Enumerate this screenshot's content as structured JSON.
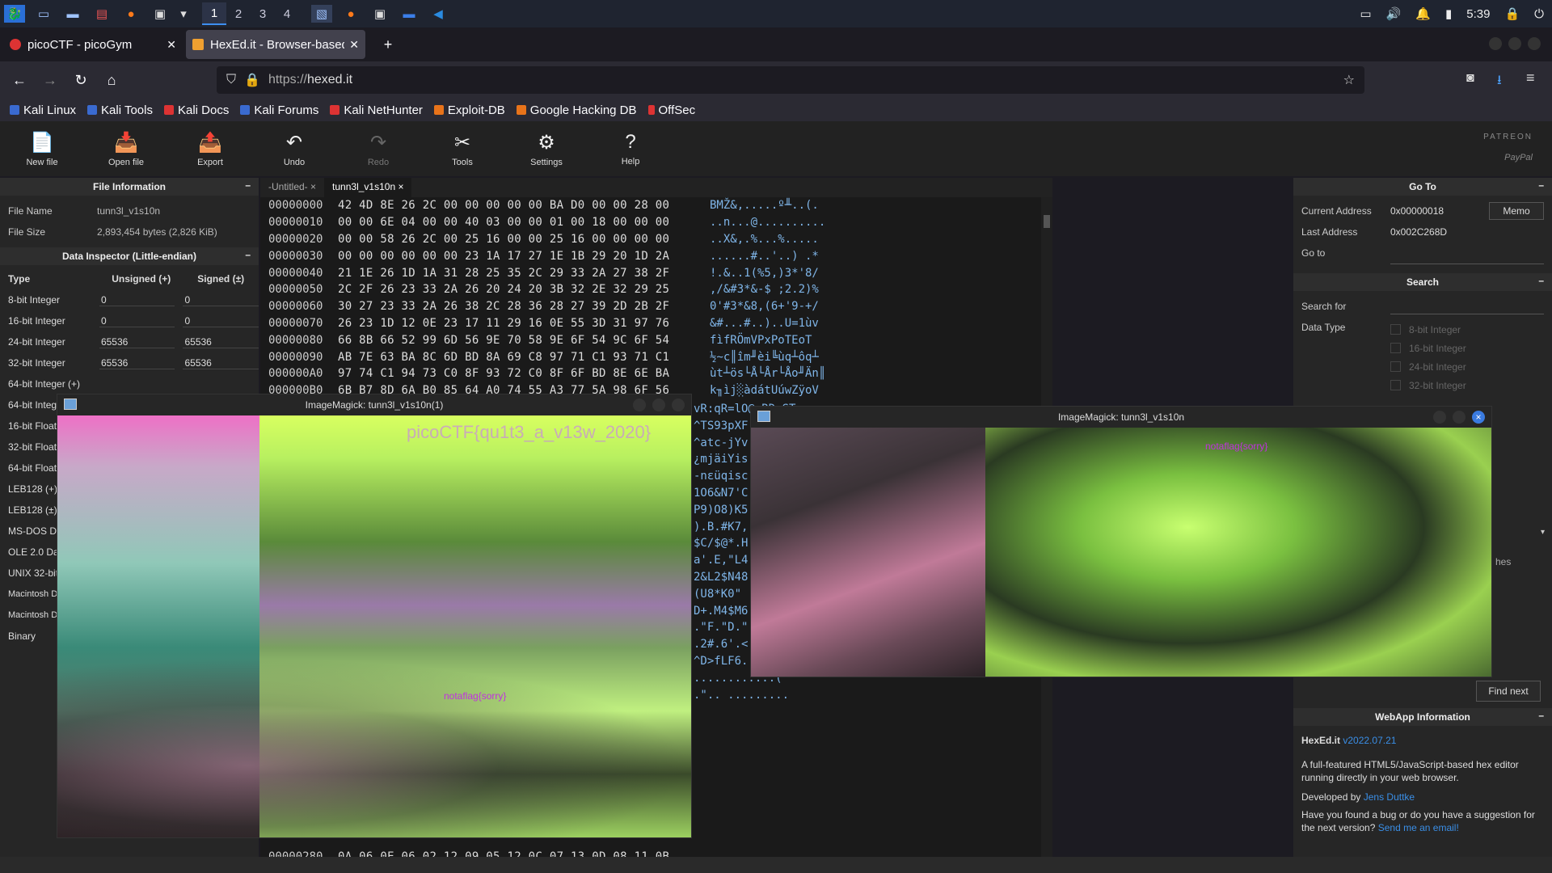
{
  "taskbar": {
    "workspaces": [
      "1",
      "2",
      "3",
      "4"
    ],
    "clock": "5:39",
    "icons": [
      "kali-menu-icon",
      "desktop-icon",
      "files-icon",
      "text-editor-icon",
      "firefox-icon",
      "terminal-icon"
    ]
  },
  "browser": {
    "tabs": [
      {
        "title": "picoCTF - picoGym",
        "active": false
      },
      {
        "title": "HexEd.it - Browser-based",
        "active": true
      }
    ],
    "url_prefix": "https://",
    "url_host": "hexed.it",
    "bookmarks": [
      "Kali Linux",
      "Kali Tools",
      "Kali Docs",
      "Kali Forums",
      "Kali NetHunter",
      "Exploit-DB",
      "Google Hacking DB",
      "OffSec"
    ]
  },
  "toolbar": {
    "items": [
      {
        "label": "New file",
        "icon": "📄"
      },
      {
        "label": "Open file",
        "icon": "📥"
      },
      {
        "label": "Export",
        "icon": "📤"
      },
      {
        "label": "Undo",
        "icon": "↶"
      },
      {
        "label": "Redo",
        "icon": "↷"
      },
      {
        "label": "Tools",
        "icon": "✂"
      },
      {
        "label": "Settings",
        "icon": "⚙"
      },
      {
        "label": "Help",
        "icon": "?"
      }
    ],
    "patreon": "PATREON",
    "paypal": "PayPal"
  },
  "file_info": {
    "header": "File Information",
    "file_name_label": "File Name",
    "file_name": "tunn3l_v1s10n",
    "file_size_label": "File Size",
    "file_size": "2,893,454 bytes (2,826 KiB)"
  },
  "inspector": {
    "header": "Data Inspector (Little-endian)",
    "col_type": "Type",
    "col_unsigned": "Unsigned (+)",
    "col_signed": "Signed (±)",
    "rows": [
      {
        "type": "8-bit Integer",
        "u": "0",
        "s": "0"
      },
      {
        "type": "16-bit Integer",
        "u": "0",
        "s": "0"
      },
      {
        "type": "24-bit Integer",
        "u": "65536",
        "s": "65536"
      },
      {
        "type": "32-bit Integer",
        "u": "65536",
        "s": "65536"
      },
      {
        "type": "64-bit Integer (+)",
        "u": "",
        "s": ""
      },
      {
        "type": "64-bit Integ",
        "u": "",
        "s": ""
      },
      {
        "type": "16-bit Float",
        "u": "",
        "s": ""
      },
      {
        "type": "32-bit Float",
        "u": "",
        "s": ""
      },
      {
        "type": "64-bit Float",
        "u": "",
        "s": ""
      },
      {
        "type": "LEB128 (+)",
        "u": "",
        "s": ""
      },
      {
        "type": "LEB128 (±)",
        "u": "",
        "s": ""
      },
      {
        "type": "MS-DOS Da",
        "u": "",
        "s": ""
      },
      {
        "type": "OLE 2.0 Dat",
        "u": "",
        "s": ""
      },
      {
        "type": "UNIX 32-bit",
        "u": "",
        "s": ""
      },
      {
        "type": "Macintosh DateTime",
        "u": "",
        "s": ""
      },
      {
        "type": "Macintosh DateTime",
        "u": "",
        "s": ""
      },
      {
        "type": "Binary",
        "u": "",
        "s": ""
      }
    ]
  },
  "editor": {
    "tabs": [
      "-Untitled-",
      "tunn3l_v1s10n"
    ],
    "rows": [
      {
        "off": "00000000",
        "bytes": "42 4D 8E 26 2C 00 00 00 00 00 BA D0 00 00 28 00",
        "asc": "BMŽ&,.....º╨..(."
      },
      {
        "off": "00000010",
        "bytes": "00 00 6E 04 00 00 40 03 00 00 01 00 18 00 00 00",
        "asc": "..n...@.........."
      },
      {
        "off": "00000020",
        "bytes": "00 00 58 26 2C 00 25 16 00 00 25 16 00 00 00 00",
        "asc": "..X&,.%...%....."
      },
      {
        "off": "00000030",
        "bytes": "00 00 00 00 00 00 23 1A 17 27 1E 1B 29 20 1D 2A",
        "asc": "......#..'..) .*"
      },
      {
        "off": "00000040",
        "bytes": "21 1E 26 1D 1A 31 28 25 35 2C 29 33 2A 27 38 2F",
        "asc": "!.&..1(%5,)3*'8/"
      },
      {
        "off": "00000050",
        "bytes": "2C 2F 26 23 33 2A 26 20 24 20 3B 32 2E 32 29 25",
        "asc": ",/&#3*&-$ ;2.2)%"
      },
      {
        "off": "00000060",
        "bytes": "30 27 23 33 2A 26 38 2C 28 36 28 27 39 2D 2B 2F",
        "asc": "0'#3*&8,(6+'9-+/"
      },
      {
        "off": "00000070",
        "bytes": "26 23 1D 12 0E 23 17 11 29 16 0E 55 3D 31 97 76",
        "asc": "&#...#..)..U=1ùv"
      },
      {
        "off": "00000080",
        "bytes": "66 8B 66 52 99 6D 56 9E 70 58 9E 6F 54 9C 6F 54",
        "asc": "fìfRÖmVPxPoTEoT"
      },
      {
        "off": "00000090",
        "bytes": "AB 7E 63 BA 8C 6D BD 8A 69 C8 97 71 C1 93 71 C1",
        "asc": "½~c║îm╜èi╚ùq┴ôq┴"
      },
      {
        "off": "000000A0",
        "bytes": "97 74 C1 94 73 C0 8F 93 72 C0 8F 6F BD 8E 6E BA",
        "asc": "ùt┴ös└Å└År└Åo╜Än║"
      },
      {
        "off": "000000B0",
        "bytes": "6B B7 8D 6A B0 85 64 A0 74 55 A3 77 5A 98 6F 56",
        "asc": "k╖ìj░àdátUúwZÿoV"
      },
      {
        "off": "00000280",
        "bytes": "0A 06 0E 06 02 12 09 05 12 0C 07 13 0D 08 11 0B",
        "asc": ""
      }
    ],
    "side_ascii": [
      "vR:qR=lO@mRDnSTw",
      "^TS93pXF",
      "^atc-jYv",
      "¿mjäiYis",
      "-nεüqisc",
      "1O6&N7'C",
      "P9)O8)K5",
      ").B.#K7,",
      "$C/$@*.H",
      "a'.E,\"L4",
      "2&L2$N48",
      "(U8*K0\"",
      "D+.M4$M6",
      ".\"F.\"D.\"",
      ".2#.6'.<",
      "^D>fLF6.",
      "............(",
      ".\".. ........."
    ]
  },
  "right": {
    "goto_header": "Go To",
    "current_address_label": "Current Address",
    "current_address": "0x00000018",
    "memo": "Memo",
    "last_address_label": "Last Address",
    "last_address": "0x002C268D",
    "goto_label": "Go to",
    "search_header": "Search",
    "search_for_label": "Search for",
    "data_type_label": "Data Type",
    "data_types": [
      "8-bit Integer",
      "16-bit Integer",
      "24-bit Integer",
      "32-bit Integer"
    ],
    "partial_hes": "hes",
    "find_next": "Find next",
    "webapp_header": "WebApp Information",
    "app_name": "HexEd.it",
    "app_version": "v2022.07.21",
    "description": "A full-featured HTML5/JavaScript-based hex editor running directly in your web browser.",
    "developed_by_label": "Developed by",
    "developer": "Jens Duttke",
    "bug_text": "Have you found a bug or do you have a suggestion for the next version?",
    "bug_link": "Send me an email!"
  },
  "windows": [
    {
      "title": "ImageMagick: tunn3l_v1s10n(1)",
      "flag": "picoCTF{qu1t3_a_v13w_2020}",
      "small": "notaflag{sorry}"
    },
    {
      "title": "ImageMagick: tunn3l_v1s10n",
      "small": "notaflag{sorry}"
    }
  ]
}
